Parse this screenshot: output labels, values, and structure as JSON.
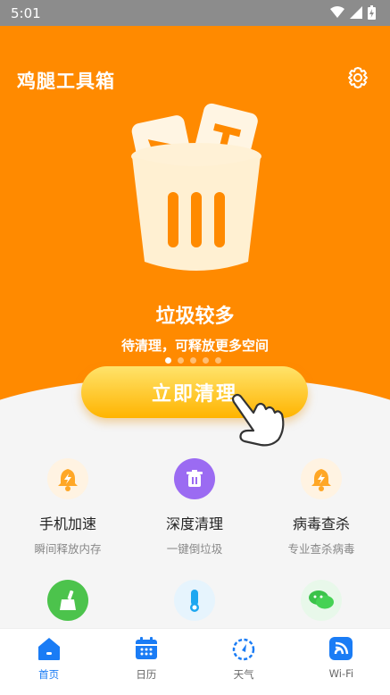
{
  "status_bar": {
    "time": "5:01"
  },
  "header": {
    "title": "鸡腿工具箱"
  },
  "hero": {
    "headline": "垃圾较多",
    "subline": "待清理，可释放更多空间",
    "page_count": 5,
    "active_page": 1,
    "cta_label": "立即清理"
  },
  "tools": [
    {
      "name": "手机加速",
      "desc": "瞬间释放内存",
      "icon": "bell-icon"
    },
    {
      "name": "深度清理",
      "desc": "一键倒垃圾",
      "icon": "trash-icon"
    },
    {
      "name": "病毒查杀",
      "desc": "专业查杀病毒",
      "icon": "bell-icon"
    },
    {
      "name": "",
      "desc": "",
      "icon": "broom-icon"
    },
    {
      "name": "",
      "desc": "",
      "icon": "thermometer-icon"
    },
    {
      "name": "",
      "desc": "",
      "icon": "wechat-icon"
    }
  ],
  "tabs": [
    {
      "label": "首页",
      "icon": "home-icon",
      "active": true
    },
    {
      "label": "日历",
      "icon": "calendar-icon",
      "active": false
    },
    {
      "label": "天气",
      "icon": "weather-icon",
      "active": false
    },
    {
      "label": "Wi-Fi",
      "icon": "wifi-icon",
      "active": false
    }
  ],
  "colors": {
    "primary": "#FF8A00",
    "accent_blue": "#1A7CF5",
    "cta": "#FFB400"
  }
}
